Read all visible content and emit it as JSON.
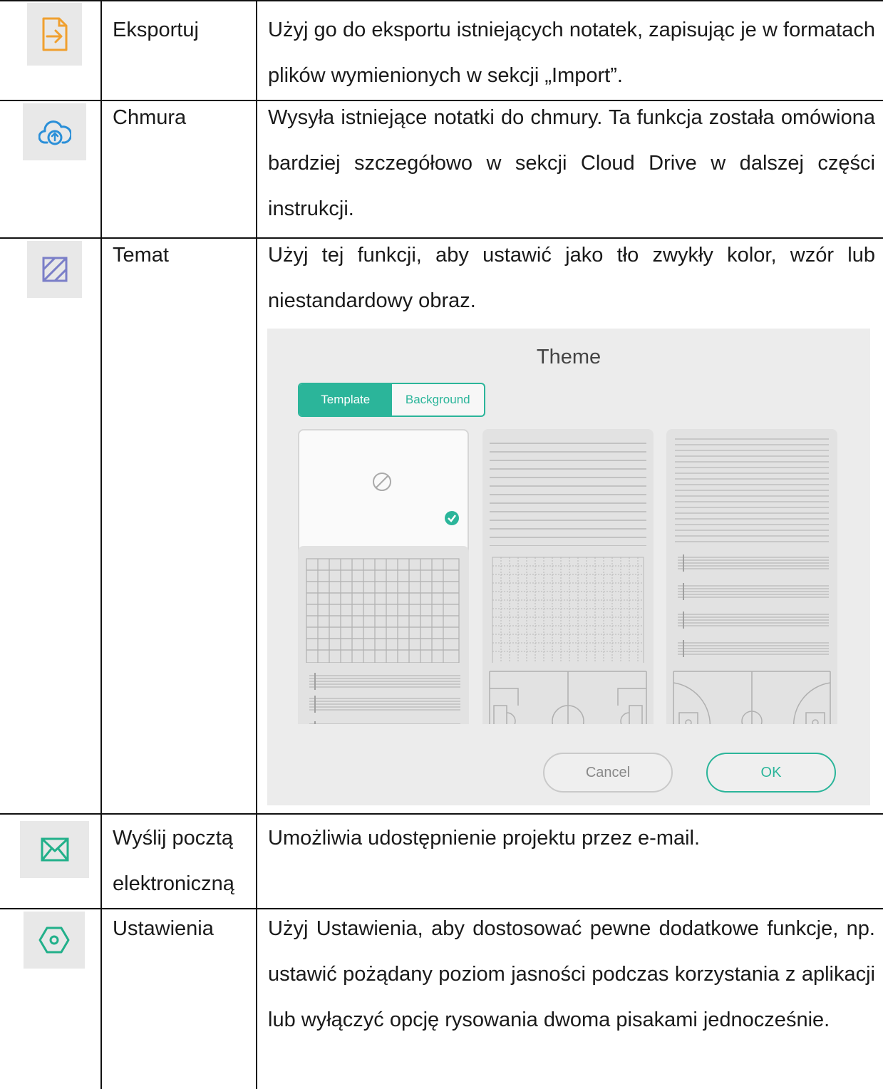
{
  "rows": [
    {
      "icon": "export-icon",
      "name": "Eksportuj",
      "desc": "Użyj go do eksportu istniejących notatek, zapisując je w formatach plików wymienionych w sekcji „Import”."
    },
    {
      "icon": "cloud-upload-icon",
      "name": "Chmura",
      "desc": "Wysyła istniejące notatki do chmury. Ta funkcja została omówiona bardziej szczegółowo w sekcji Cloud Drive w dalszej części instrukcji."
    },
    {
      "icon": "theme-hatch-icon",
      "name": "Temat",
      "desc": "Użyj tej funkcji, aby ustawić jako tło zwykły kolor, wzór lub niestandardowy obraz."
    },
    {
      "icon": "mail-icon",
      "name_line1": "Wyślij pocztą",
      "name_line2": "elektroniczną",
      "desc": "Umożliwia udostępnienie projektu przez e-mail."
    },
    {
      "icon": "settings-hex-icon",
      "name": "Ustawienia",
      "desc": "Użyj Ustawienia, aby dostosować pewne dodatkowe funkcje, np. ustawić pożądany poziom jasności podczas korzystania z aplikacji lub wyłączyć opcję rysowania dwoma pisakami jednocześnie."
    }
  ],
  "theme_dialog": {
    "title": "Theme",
    "tab_template": "Template",
    "tab_background": "Background",
    "cancel": "Cancel",
    "ok": "OK",
    "accent": "#2bb59a"
  },
  "colors": {
    "export": "#f0a030",
    "cloud": "#2a8fd8",
    "theme": "#7b7fc8",
    "mail": "#22b08a",
    "settings": "#22b08a"
  }
}
